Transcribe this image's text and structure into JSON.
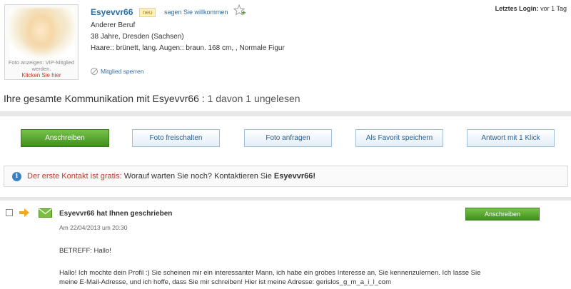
{
  "profile": {
    "photo_hint": "Foto anzeigen: VIP-Mitglied werden.",
    "photo_link": "Klicken Sie hier",
    "username": "Esyevvr66",
    "badge": "neu",
    "welcome_link": "sagen Sie willkommen",
    "last_login_label": "Letztes Login:",
    "last_login_value": "vor 1 Tag",
    "job": "Anderer Beruf",
    "age_location": "38 Jahre, Dresden (Sachsen)",
    "attributes": "Haare:: brünett, lang. Augen:: braun. 168 cm, , Normale Figur",
    "block_link": "Mitglied sperren"
  },
  "communication": {
    "title": "Ihre gesamte Kommunikation mit Esyevvr66 :",
    "count": "1 davon 1 ungelesen"
  },
  "actions": {
    "write": "Anschreiben",
    "unlock_photo": "Foto freischalten",
    "request_photo": "Foto anfragen",
    "save_favorite": "Als Favorit speichern",
    "one_click_reply": "Antwort mit 1 Klick"
  },
  "banner": {
    "red_text": "Der erste Kontakt ist gratis:",
    "text": "Worauf warten Sie noch? Kontaktieren Sie",
    "user": "Esyevvr66!"
  },
  "message": {
    "title": "Esyevvr66 hat Ihnen geschrieben",
    "reply_label": "Anschreiben",
    "date": "Am 22/04/2013 um 20:30",
    "subject": "BETREFF: Hallo!",
    "body": "Hallo! Ich mochte dein Profil :) Sie scheinen mir ein interessanter Mann, ich habe ein grobes Interesse an, Sie kennenzulernen. Ich lasse Sie meine E-Mail-Adresse, und ich hoffe, dass Sie mir schreiben! Hier ist meine Adresse: gerislos_g_m_a_i_l_com"
  },
  "colors": {
    "link_blue": "#2a6ea6",
    "button_green": "#4fa22a",
    "accent_red": "#c0392b"
  },
  "icons": [
    "star-add-icon",
    "block-icon",
    "info-icon",
    "arrow-right-icon",
    "envelope-icon"
  ]
}
